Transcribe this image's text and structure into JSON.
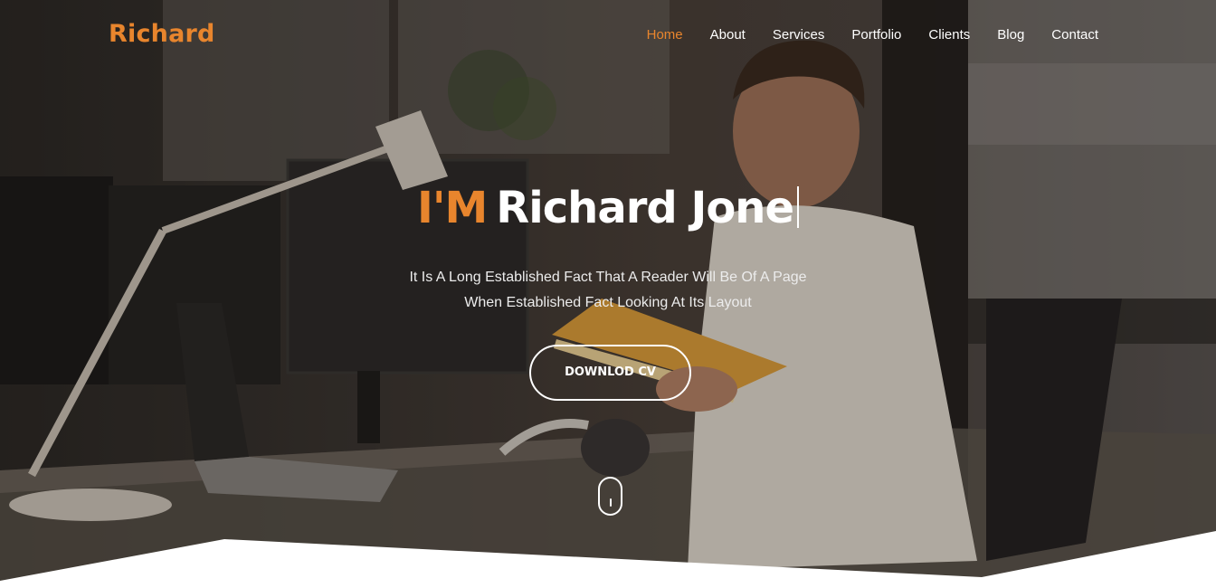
{
  "brand": {
    "name": "Richard",
    "accent_color": "#e8852d"
  },
  "nav": {
    "items": [
      {
        "label": "Home",
        "active": true
      },
      {
        "label": "About",
        "active": false
      },
      {
        "label": "Services",
        "active": false
      },
      {
        "label": "Portfolio",
        "active": false
      },
      {
        "label": "Clients",
        "active": false
      },
      {
        "label": "Blog",
        "active": false
      },
      {
        "label": "Contact",
        "active": false
      }
    ]
  },
  "hero": {
    "title_prefix": "I'M",
    "title_name": "Richard Jone",
    "subtitle_line1": "It Is A Long Established Fact That A Reader Will Be Of A Page",
    "subtitle_line2": "When Established Fact Looking At Its Layout",
    "cta_label": "DOWNLOD CV",
    "scroll_icon": "mouse-scroll-icon"
  }
}
